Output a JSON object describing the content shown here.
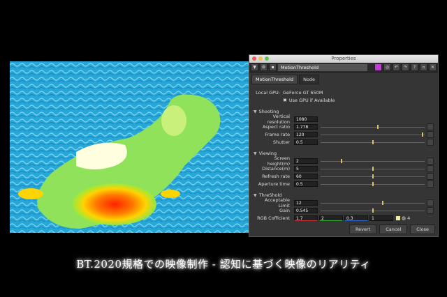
{
  "window": {
    "title": "Properties"
  },
  "toolbar": {
    "node_name": "MotionThreshold"
  },
  "tabs": [
    {
      "label": "MotionThreshold"
    },
    {
      "label": "Node"
    }
  ],
  "local_gpu": {
    "label": "Local GPU:",
    "value": "GeForce GT 650M",
    "checkbox_label": "Use GPU if Available"
  },
  "sections": {
    "shooting": {
      "title": "Shooting"
    },
    "viewing": {
      "title": "Viewing"
    },
    "threshold": {
      "title": "ThreShold"
    }
  },
  "fields": {
    "vres": {
      "label": "Vertical resolution",
      "value": "1080"
    },
    "aspect": {
      "label": "Aspect ratio",
      "value": "1.778",
      "level": 0.55
    },
    "fps": {
      "label": "Frame rate",
      "value": "120",
      "level": 0.98
    },
    "shutter": {
      "label": "Shutter",
      "value": "0.5",
      "level": 0.5
    },
    "screen": {
      "label": "Screen height(m)",
      "value": "2",
      "level": 0.2
    },
    "distance": {
      "label": "Distance(m)",
      "value": "5",
      "level": 0.5
    },
    "refresh": {
      "label": "Refresh rate",
      "value": "60",
      "level": 0.5
    },
    "aperture": {
      "label": "Aperture time",
      "value": "0.5",
      "level": 0.5
    },
    "accept": {
      "label": "Acceptable Limit",
      "value": "12",
      "level": 0.6
    },
    "gain": {
      "label": "Gain",
      "value": "0.545",
      "level": 0.5
    },
    "rgb": {
      "label": "RGB Cofficient",
      "r": "1.7",
      "g": "2",
      "b": "0.3",
      "a": "1",
      "count": "4"
    }
  },
  "buttons": {
    "revert": "Revert",
    "cancel": "Cancel",
    "close": "Close"
  },
  "caption": "BT.2020規格での映像制作 - 認知に基づく映像のリアリティ",
  "colors": {
    "panel": "#353535",
    "titlebar": "#d8d8d8",
    "knob": "#d9c46a",
    "accent": "#c23ad6"
  }
}
